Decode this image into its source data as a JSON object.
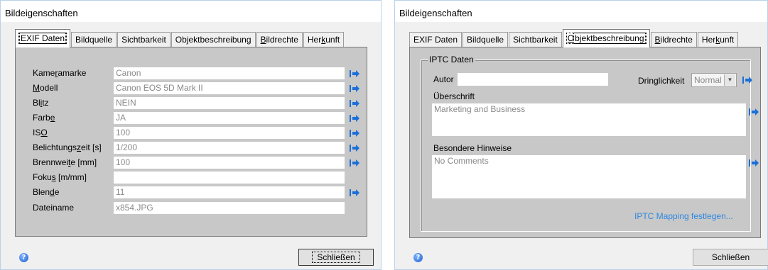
{
  "left": {
    "title": "Bildeigenschaften",
    "tabs": [
      {
        "pre": "EXIF Daten",
        "u": "",
        "post": ""
      },
      {
        "pre": "Bildquelle",
        "u": "",
        "post": ""
      },
      {
        "pre": "Sichtbarkeit",
        "u": "",
        "post": ""
      },
      {
        "pre": "Objektbeschreibung",
        "u": "",
        "post": ""
      },
      {
        "pre": "",
        "u": "B",
        "post": "ildrechte"
      },
      {
        "pre": "Her",
        "u": "k",
        "post": "unft"
      }
    ],
    "fields": [
      {
        "pre": "Kame",
        "u": "r",
        "post": "amarke",
        "value": "Canon"
      },
      {
        "pre": "",
        "u": "M",
        "post": "odell",
        "value": "Canon EOS 5D Mark II"
      },
      {
        "pre": "Bl",
        "u": "i",
        "post": "tz",
        "value": "NEIN"
      },
      {
        "pre": "Farb",
        "u": "e",
        "post": "",
        "value": "JA"
      },
      {
        "pre": "IS",
        "u": "O",
        "post": "",
        "value": "100"
      },
      {
        "pre": "Belichtungs",
        "u": "z",
        "post": "eit [s]",
        "value": "1/200"
      },
      {
        "pre": "Brennwei",
        "u": "t",
        "post": "e [mm]",
        "value": "100"
      },
      {
        "pre": "Foku",
        "u": "s",
        "post": " [m/mm]",
        "value": ""
      },
      {
        "pre": "Blen",
        "u": "d",
        "post": "e",
        "value": "11"
      },
      {
        "pre": "Dateiname",
        "u": "",
        "post": "",
        "value": "x854.JPG"
      }
    ],
    "close": "Schließen",
    "help": "?"
  },
  "right": {
    "title": "Bildeigenschaften",
    "tabs": [
      {
        "pre": "EXIF Daten",
        "u": "",
        "post": ""
      },
      {
        "pre": "Bildquelle",
        "u": "",
        "post": ""
      },
      {
        "pre": "Sichtbarkeit",
        "u": "",
        "post": ""
      },
      {
        "pre": "",
        "u": "O",
        "post": "bjektbeschreibung"
      },
      {
        "pre": "",
        "u": "B",
        "post": "ildrechte"
      },
      {
        "pre": "Her",
        "u": "k",
        "post": "unft"
      }
    ],
    "group_title": "IPTC Daten",
    "autor_label": "Autor",
    "autor_value": "",
    "dringlichkeit_label": "Dringlichkeit",
    "dringlichkeit_value": "Normal",
    "ueberschrift_label": "Überschrift",
    "ueberschrift_value": "Marketing and Business",
    "hinweise_label": "Besondere Hinweise",
    "hinweise_value": "No Comments",
    "mapping_link": "IPTC Mapping festlegen...",
    "close": "Schließen",
    "help": "?"
  },
  "colors": {
    "arrow": "#1c6fd8",
    "link": "#2f87e0",
    "panel": "#c8c8c8"
  },
  "icons": {
    "arrow": "arrow-right-icon",
    "help": "help-icon"
  }
}
